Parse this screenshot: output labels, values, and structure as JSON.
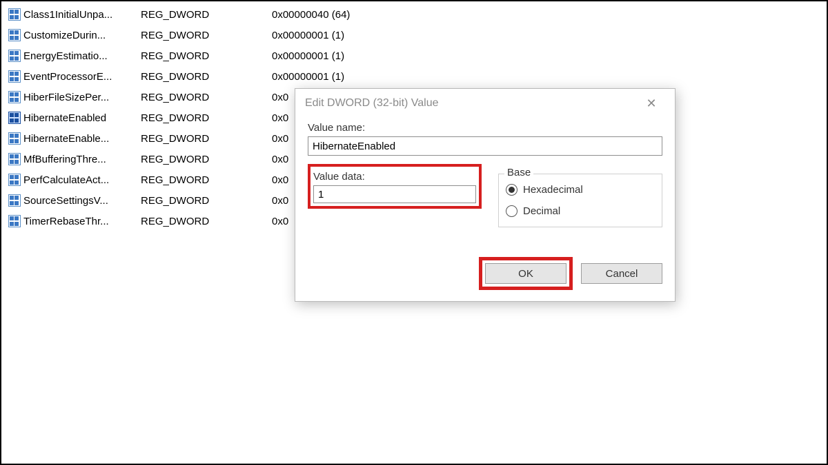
{
  "registry": {
    "rows": [
      {
        "name": "Class1InitialUnpa...",
        "type": "REG_DWORD",
        "data": "0x00000040 (64)"
      },
      {
        "name": "CustomizeDurin...",
        "type": "REG_DWORD",
        "data": "0x00000001 (1)"
      },
      {
        "name": "EnergyEstimatio...",
        "type": "REG_DWORD",
        "data": "0x00000001 (1)"
      },
      {
        "name": "EventProcessorE...",
        "type": "REG_DWORD",
        "data": "0x00000001 (1)"
      },
      {
        "name": "HiberFileSizePer...",
        "type": "REG_DWORD",
        "data": "0x0"
      },
      {
        "name": "HibernateEnabled",
        "type": "REG_DWORD",
        "data": "0x0",
        "selected": true
      },
      {
        "name": "HibernateEnable...",
        "type": "REG_DWORD",
        "data": "0x0"
      },
      {
        "name": "MfBufferingThre...",
        "type": "REG_DWORD",
        "data": "0x0"
      },
      {
        "name": "PerfCalculateAct...",
        "type": "REG_DWORD",
        "data": "0x0"
      },
      {
        "name": "SourceSettingsV...",
        "type": "REG_DWORD",
        "data": "0x0"
      },
      {
        "name": "TimerRebaseThr...",
        "type": "REG_DWORD",
        "data": "0x0"
      }
    ]
  },
  "dialog": {
    "title": "Edit DWORD (32-bit) Value",
    "close": "✕",
    "valueNameLabel": "Value name:",
    "valueName": "HibernateEnabled",
    "valueDataLabel": "Value data:",
    "valueData": "1",
    "baseLabel": "Base",
    "hexLabel": "Hexadecimal",
    "decLabel": "Decimal",
    "ok": "OK",
    "cancel": "Cancel"
  }
}
